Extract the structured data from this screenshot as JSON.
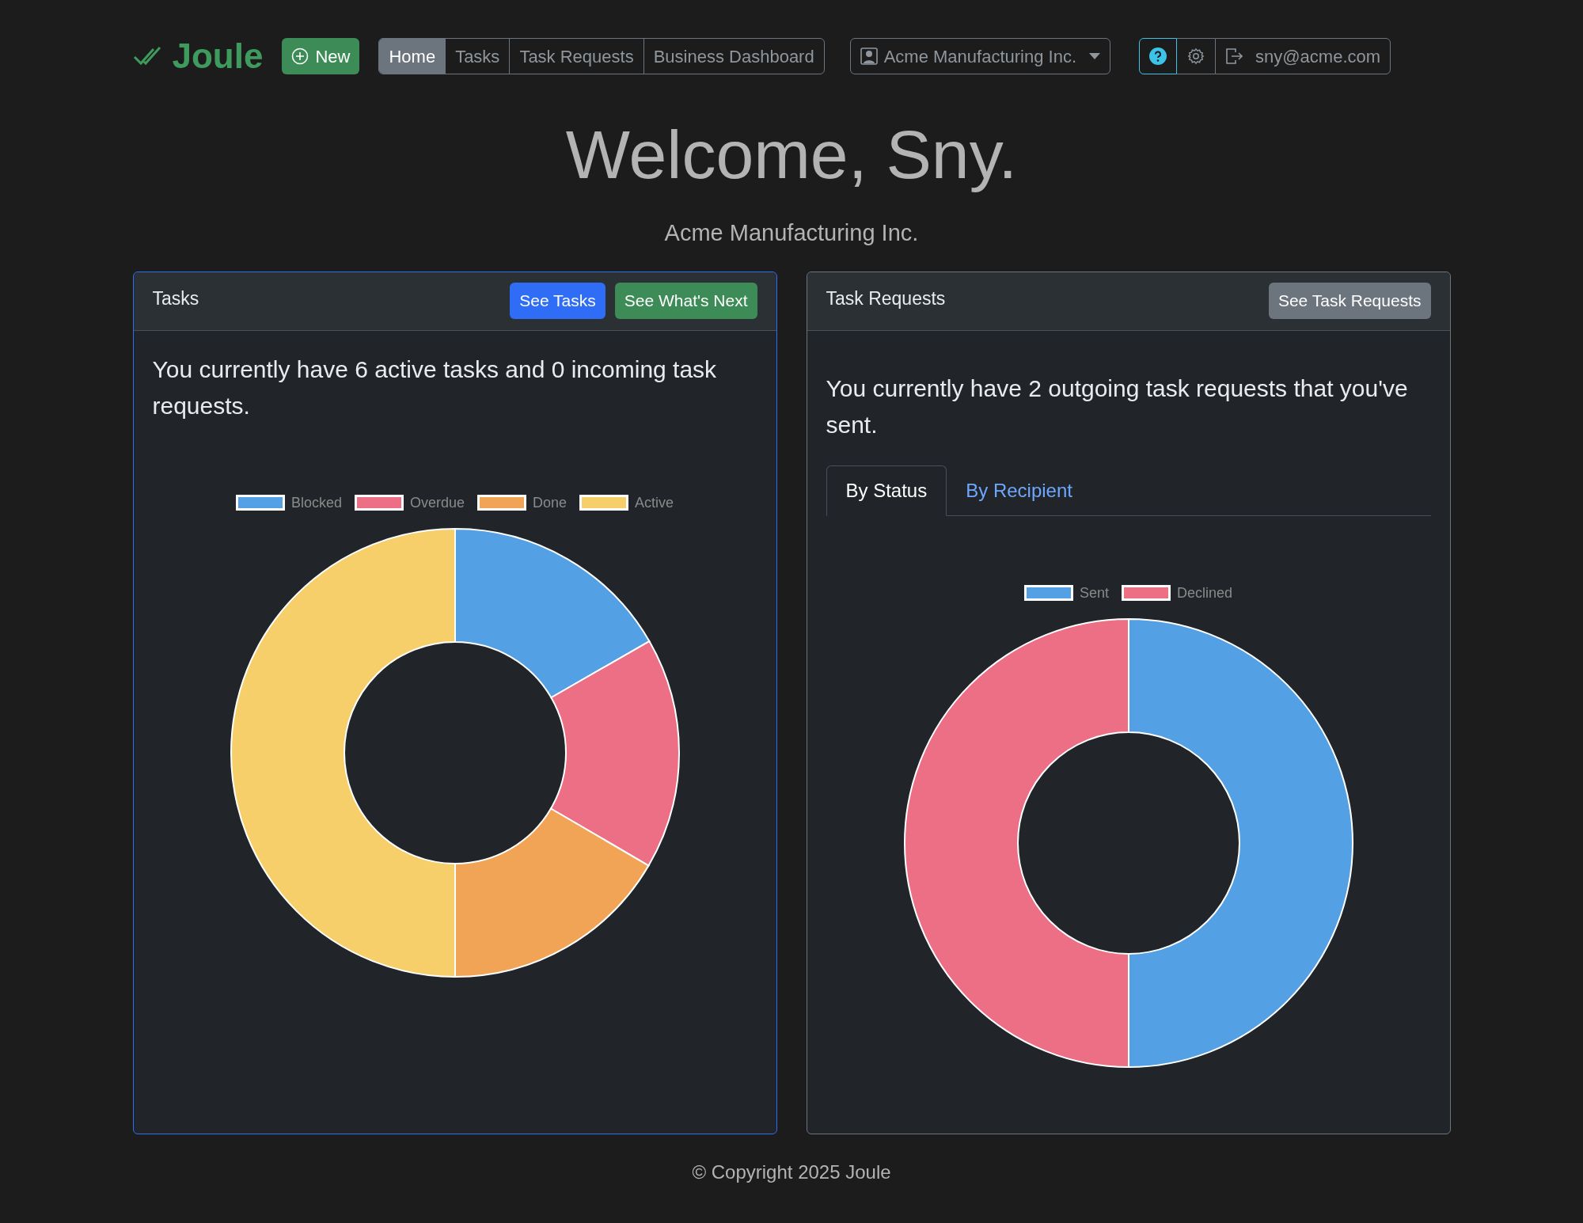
{
  "brand": {
    "name": "Joule"
  },
  "new_button": {
    "label": "New"
  },
  "nav_tabs": [
    {
      "label": "Home",
      "selected": true
    },
    {
      "label": "Tasks",
      "selected": false
    },
    {
      "label": "Task Requests",
      "selected": false
    },
    {
      "label": "Business Dashboard",
      "selected": false
    }
  ],
  "org_dropdown": {
    "label": "Acme Manufacturing Inc."
  },
  "user_menu": {
    "email": "sny@acme.com"
  },
  "hero": {
    "title": "Welcome, Sny.",
    "subtitle": "Acme Manufacturing Inc."
  },
  "cards": [
    {
      "title": "Tasks",
      "focused": true,
      "buttons": [
        {
          "label": "See Tasks",
          "kind": "primary"
        },
        {
          "label": "See What's Next",
          "kind": "success"
        }
      ],
      "text": "You currently have 6 active tasks and 0 incoming task requests.",
      "chart_data": {
        "type": "donut",
        "legend": "top",
        "categories": [
          "Blocked",
          "Overdue",
          "Done",
          "Active"
        ],
        "values": [
          16.7,
          16.7,
          16.6,
          50
        ],
        "colors": [
          "#54a0e4",
          "#ec6f86",
          "#f1a455",
          "#f6cf6b"
        ]
      }
    },
    {
      "title": "Task Requests",
      "focused": false,
      "buttons": [
        {
          "label": "See Task Requests",
          "kind": "secondary"
        }
      ],
      "text": "You currently have 2 outgoing task requests that you've sent.",
      "tabs": [
        {
          "label": "By Status",
          "selected": true
        },
        {
          "label": "By Recipient",
          "selected": false
        }
      ],
      "chart_data": {
        "type": "donut",
        "legend": "top",
        "categories": [
          "Sent",
          "Declined"
        ],
        "values": [
          50,
          50
        ],
        "colors": [
          "#54a0e4",
          "#ec6f86"
        ]
      }
    }
  ],
  "footer": {
    "text": "© Copyright 2025 Joule"
  }
}
